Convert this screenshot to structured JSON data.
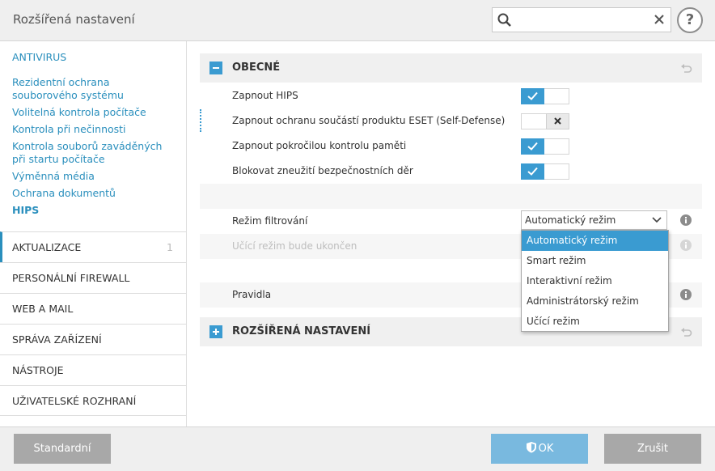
{
  "window": {
    "title": "Rozšířená nastavení"
  },
  "search": {
    "placeholder": "",
    "value": ""
  },
  "help": {
    "label": "?"
  },
  "sidebar": {
    "heading": "ANTIVIRUS",
    "sub_items": [
      {
        "label": "Rezidentní ochrana souborového systému"
      },
      {
        "label": "Volitelná kontrola počítače"
      },
      {
        "label": "Kontrola při nečinnosti"
      },
      {
        "label": "Kontrola souborů zaváděných při startu počítače"
      },
      {
        "label": "Výměnná média"
      },
      {
        "label": "Ochrana dokumentů"
      },
      {
        "label": "HIPS"
      }
    ],
    "sections": [
      {
        "label": "AKTUALIZACE",
        "count": "1"
      },
      {
        "label": "PERSONÁLNÍ FIREWALL"
      },
      {
        "label": "WEB A MAIL"
      },
      {
        "label": "SPRÁVA ZAŘÍZENÍ"
      },
      {
        "label": "NÁSTROJE"
      },
      {
        "label": "UŽIVATELSKÉ ROZHRANÍ"
      }
    ]
  },
  "main": {
    "general": {
      "title": "OBECNÉ",
      "toggle_symbol": "−",
      "rows": [
        {
          "label": "Zapnout HIPS",
          "state": "on"
        },
        {
          "label": "Zapnout ochranu součástí produktu ESET (Self-Defense)",
          "state": "off"
        },
        {
          "label": "Zapnout pokročilou kontrolu paměti",
          "state": "on"
        },
        {
          "label": "Blokovat zneužití bezpečnostních děr",
          "state": "on"
        }
      ],
      "filter_mode": {
        "label": "Režim filtrování",
        "selected": "Automatický režim",
        "options": [
          "Automatický režim",
          "Smart režim",
          "Interaktivní režim",
          "Administrátorský režim",
          "Učící režim"
        ]
      },
      "learning_end_label": "Učící režim bude ukončen",
      "rules_label": "Pravidla"
    },
    "advanced": {
      "title": "ROZŠÍŘENÁ NASTAVENÍ",
      "toggle_symbol": "+"
    }
  },
  "footer": {
    "standard_label": "Standardní",
    "ok_label": "OK",
    "cancel_label": "Zrušit"
  },
  "colors": {
    "accent": "#3a9bd1",
    "link": "#2a8fbd",
    "button_gray": "#a8a8a8",
    "button_ok": "#79b9df"
  }
}
